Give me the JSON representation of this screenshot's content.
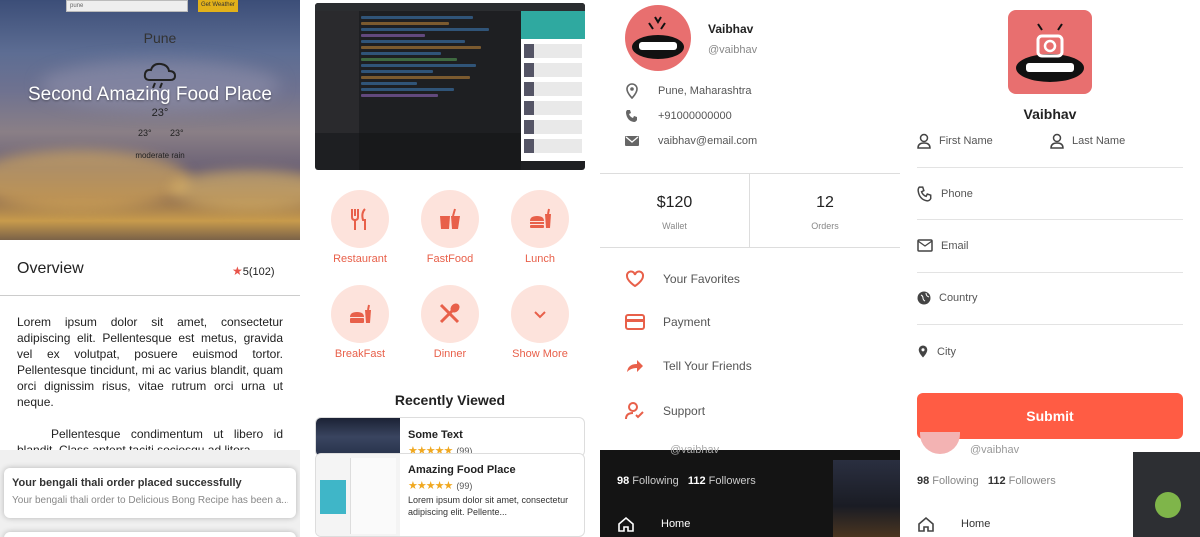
{
  "weather": {
    "search_value": "pune",
    "button_label": "Get Weather",
    "city": "Pune",
    "temp": "23°",
    "min": "23°",
    "max": "23°",
    "description": "moderate rain"
  },
  "place": {
    "title": "Second Amazing Food Place",
    "overview_label": "Overview",
    "rating": "5",
    "reviews": "(102)",
    "para1": "Lorem ipsum dolor sit amet, consectetur adipiscing elit. Pellentesque est metus, gravida vel ex volutpat, posuere euismod tortor. Pellentesque tincidunt, mi ac varius blandit, quam orci dignissim risus, vitae rutrum orci urna ut neque.",
    "para2": "Pellentesque condimentum ut libero id blandit. Class aptent taciti sociosqu ad litora"
  },
  "toast": {
    "title": "Your bengali thali order placed successfully",
    "body": "Your bengali thali order to Delicious Bong Recipe has been a..."
  },
  "categories": [
    {
      "label": "Restaurant",
      "icon": "fork-knife-icon"
    },
    {
      "label": "FastFood",
      "icon": "fastfood-icon"
    },
    {
      "label": "Lunch",
      "icon": "burger-drink-icon"
    },
    {
      "label": "BreakFast",
      "icon": "breakfast-icon"
    },
    {
      "label": "Dinner",
      "icon": "dinner-icon"
    },
    {
      "label": "Show More",
      "icon": "chevron-down-icon"
    }
  ],
  "recently_viewed": {
    "title": "Recently Viewed",
    "items": [
      {
        "name": "Some Text",
        "count": "(99)"
      },
      {
        "name": "Amazing Food Place",
        "count": "(99)",
        "desc": "Lorem ipsum dolor sit amet, consectetur adipiscing elit. Pellente..."
      }
    ]
  },
  "profile": {
    "name": "Vaibhav",
    "handle": "@vaibhav",
    "location": "Pune, Maharashtra",
    "phone": "+91000000000",
    "email": "vaibhav@email.com",
    "wallet_value": "$120",
    "wallet_label": "Wallet",
    "orders_value": "12",
    "orders_label": "Orders",
    "menu": [
      "Your Favorites",
      "Payment",
      "Tell Your Friends",
      "Support"
    ],
    "following_count": "98",
    "following_label": "Following",
    "followers_count": "112",
    "followers_label": "Followers",
    "home_label": "Home",
    "brand_color": "#e8604a"
  },
  "form": {
    "name": "Vaibhav",
    "first_name": "First Name",
    "last_name": "Last Name",
    "phone": "Phone",
    "email": "Email",
    "country": "Country",
    "city": "City",
    "submit": "Submit",
    "submit_color": "#ff5c44"
  }
}
